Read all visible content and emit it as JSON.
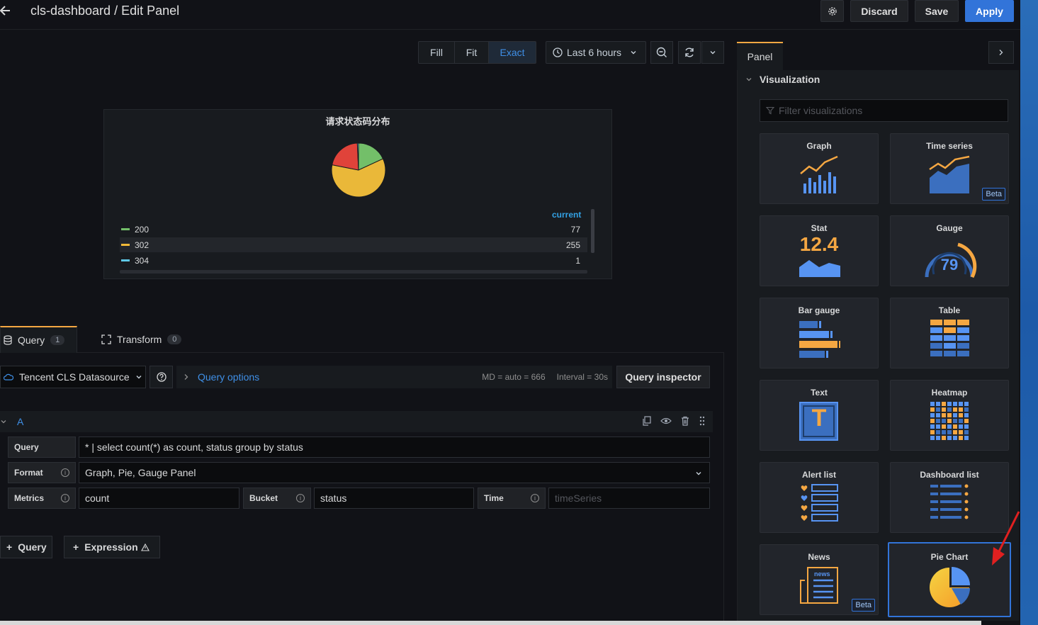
{
  "header": {
    "title": "cls-dashboard / Edit Panel",
    "discard_label": "Discard",
    "save_label": "Save",
    "apply_label": "Apply"
  },
  "toolbar": {
    "fill_label": "Fill",
    "fit_label": "Fit",
    "exact_label": "Exact",
    "time_range": "Last 6 hours"
  },
  "panel": {
    "title": "请求状态码分布",
    "legend_header": "current",
    "legend": [
      {
        "name": "200",
        "value": "77",
        "color": "#73bf69"
      },
      {
        "name": "302",
        "value": "255",
        "color": "#f2b937"
      },
      {
        "name": "304",
        "value": "1",
        "color": "#5ec8e6"
      }
    ],
    "slice_colors": {
      "200": "#73bf69",
      "302": "#eab839",
      "other": "#e0433a"
    }
  },
  "tabs": {
    "query_label": "Query",
    "query_count": "1",
    "transform_label": "Transform",
    "transform_count": "0"
  },
  "datasource": {
    "name": "Tencent CLS Datasource",
    "query_options_label": "Query options",
    "md_text": "MD = auto = 666",
    "interval_text": "Interval = 30s",
    "inspector_label": "Query inspector"
  },
  "query": {
    "letter": "A",
    "query_label": "Query",
    "query_value": "* | select count(*) as count, status group by status",
    "format_label": "Format",
    "format_value": "Graph, Pie, Gauge Panel",
    "metrics_label": "Metrics",
    "metrics_value": "count",
    "bucket_label": "Bucket",
    "bucket_value": "status",
    "time_label": "Time",
    "time_placeholder": "timeSeries",
    "add_query_label": "Query",
    "add_expression_label": "Expression"
  },
  "options": {
    "tab_label": "Panel",
    "section_label": "Visualization",
    "filter_placeholder": "Filter visualizations",
    "visualizations": [
      {
        "name": "Graph",
        "icon": "graph-icon"
      },
      {
        "name": "Time series",
        "icon": "time-series-icon",
        "badge": "Beta"
      },
      {
        "name": "Stat",
        "icon": "stat-icon",
        "icon_text": "12.4"
      },
      {
        "name": "Gauge",
        "icon": "gauge-icon",
        "icon_text": "79"
      },
      {
        "name": "Bar gauge",
        "icon": "bar-gauge-icon"
      },
      {
        "name": "Table",
        "icon": "table-icon"
      },
      {
        "name": "Text",
        "icon": "text-icon",
        "icon_text": "T"
      },
      {
        "name": "Heatmap",
        "icon": "heatmap-icon"
      },
      {
        "name": "Alert list",
        "icon": "alert-list-icon"
      },
      {
        "name": "Dashboard list",
        "icon": "dashboard-list-icon"
      },
      {
        "name": "News",
        "icon": "news-icon",
        "badge": "Beta",
        "icon_text": "news"
      },
      {
        "name": "Pie Chart",
        "icon": "pie-chart-icon",
        "selected": true
      }
    ]
  },
  "colors": {
    "accent_blue": "#3274d9",
    "tab_orange": "#f5a742",
    "link_blue": "#3f8fe6"
  }
}
